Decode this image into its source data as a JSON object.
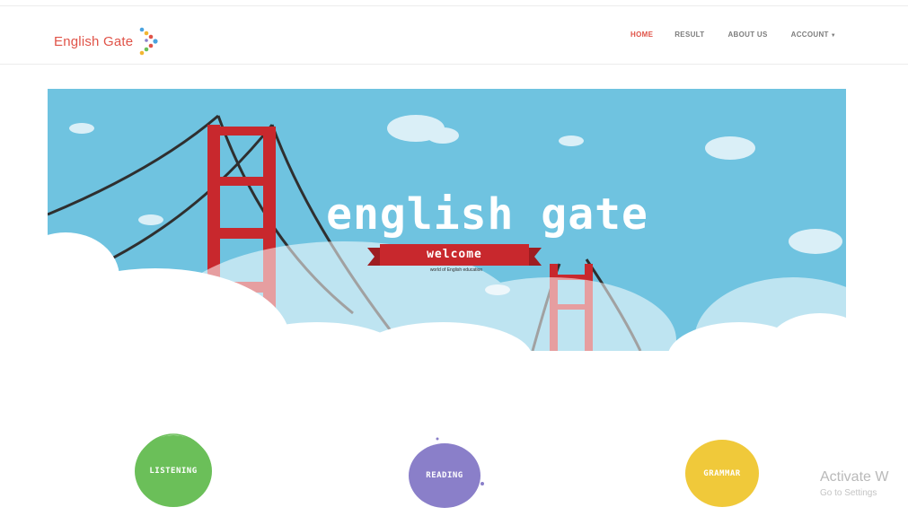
{
  "brand": {
    "name": "English Gate",
    "logo_icon": "arrow-chevron-dots-icon"
  },
  "nav": {
    "items": [
      {
        "label": "HOME",
        "active": true
      },
      {
        "label": "RESULT",
        "active": false
      },
      {
        "label": "ABOUT US",
        "active": false
      },
      {
        "label": "ACCOUNT",
        "active": false,
        "has_dropdown": true
      }
    ],
    "active_color": "#e05348"
  },
  "hero": {
    "title": "english gate",
    "ribbon_label": "welcome",
    "tagline": "world of English education",
    "background_color": "#6fc3e0"
  },
  "skills": [
    {
      "label": "LISTENING",
      "color": "#6bbf59"
    },
    {
      "label": "READING",
      "color": "#8a7fc9"
    },
    {
      "label": "GRAMMAR",
      "color": "#f0c93a"
    }
  ],
  "watermark": {
    "line1": "Activate W",
    "line2": "Go to Settings"
  }
}
